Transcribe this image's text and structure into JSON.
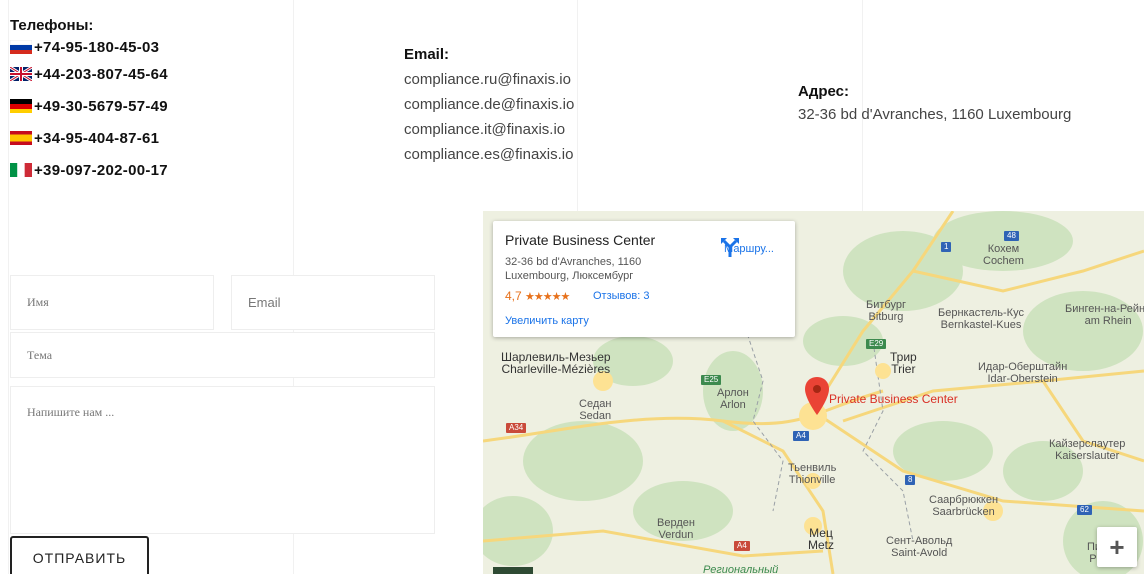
{
  "phones": {
    "title": "Телефоны:",
    "items": [
      {
        "country": "ru",
        "flag_icon": "russia-flag-icon",
        "number": "+74-95-180-45-03"
      },
      {
        "country": "gb",
        "flag_icon": "uk-flag-icon",
        "number": "+44-203-807-45-64"
      },
      {
        "country": "de",
        "flag_icon": "germany-flag-icon",
        "number": "+49-30-5679-57-49"
      },
      {
        "country": "es",
        "flag_icon": "spain-flag-icon",
        "number": "+34-95-404-87-61"
      },
      {
        "country": "it",
        "flag_icon": "italy-flag-icon",
        "number": "+39-097-202-00-17"
      }
    ]
  },
  "email": {
    "title": "Email:",
    "items": [
      "compliance.ru@finaxis.io",
      "compliance.de@finaxis.io",
      "compliance.it@finaxis.io",
      "compliance.es@finaxis.io"
    ]
  },
  "address": {
    "title": "Адрес:",
    "line": "32-36 bd d'Avranches, 1160 Luxembourg"
  },
  "form": {
    "name_placeholder": "Имя",
    "email_placeholder": "Email",
    "subject_placeholder": "Тема",
    "message_placeholder": "Напишите нам ...",
    "submit_label": "ОТПРАВИТЬ"
  },
  "map": {
    "card": {
      "title": "Private Business Center",
      "address_line1": "32-36 bd d'Avranches, 1160",
      "address_line2": "Luxembourg, Люксембург",
      "rating": "4,7",
      "stars": "★★★★★",
      "reviews": "Отзывов: 3",
      "enlarge": "Увеличить карту",
      "route": "Маршру..."
    },
    "pin_label": "Private Business Center",
    "zoom_in": "+",
    "places": {
      "charleville_ru": "Шарлевиль-Мезьер",
      "charleville": "Charleville-Mézières",
      "sedan_ru": "Седан",
      "sedan": "Sedan",
      "arlon_ru": "Арлон",
      "arlon": "Arlon",
      "bitburg_ru": "Битбург",
      "bitburg": "Bitburg",
      "trier_ru": "Трир",
      "trier": "Trier",
      "bernkastel_ru": "Бернкастель-Кус",
      "bernkastel": "Bernkastel-Kues",
      "bingen_ru": "Бинген-на-Рейне",
      "bingen_a": "am Rhein",
      "idar_ru": "Идар-Оберштайн",
      "idar": "Idar-Oberstein",
      "cochem_ru": "Кохем",
      "cochem": "Cochem",
      "thionville_ru": "Тьенвиль",
      "thionville": "Thionville",
      "kaiserslautern_ru": "Кайзерслаутер",
      "kaiserslautern": "Kaiserslauter",
      "saarbrucken_ru": "Саарбрюккен",
      "saarbrucken": "Saarbrücken",
      "verdun_ru": "Верден",
      "verdun": "Verdun",
      "metz_ru": "Мец",
      "metz": "Metz",
      "saintavold_ru": "Сент-Авольд",
      "saintavold": "Saint-Avold",
      "pirmasens_ru": "Пирмазе",
      "pirmasens": "Pirmase",
      "regional": "Региональный"
    },
    "roads": {
      "e25": "E25",
      "e29": "E29",
      "a34": "A34",
      "a4_1": "A4",
      "a4_2": "A4",
      "r48": "48",
      "r1": "1",
      "r8": "8",
      "r62": "62"
    }
  }
}
